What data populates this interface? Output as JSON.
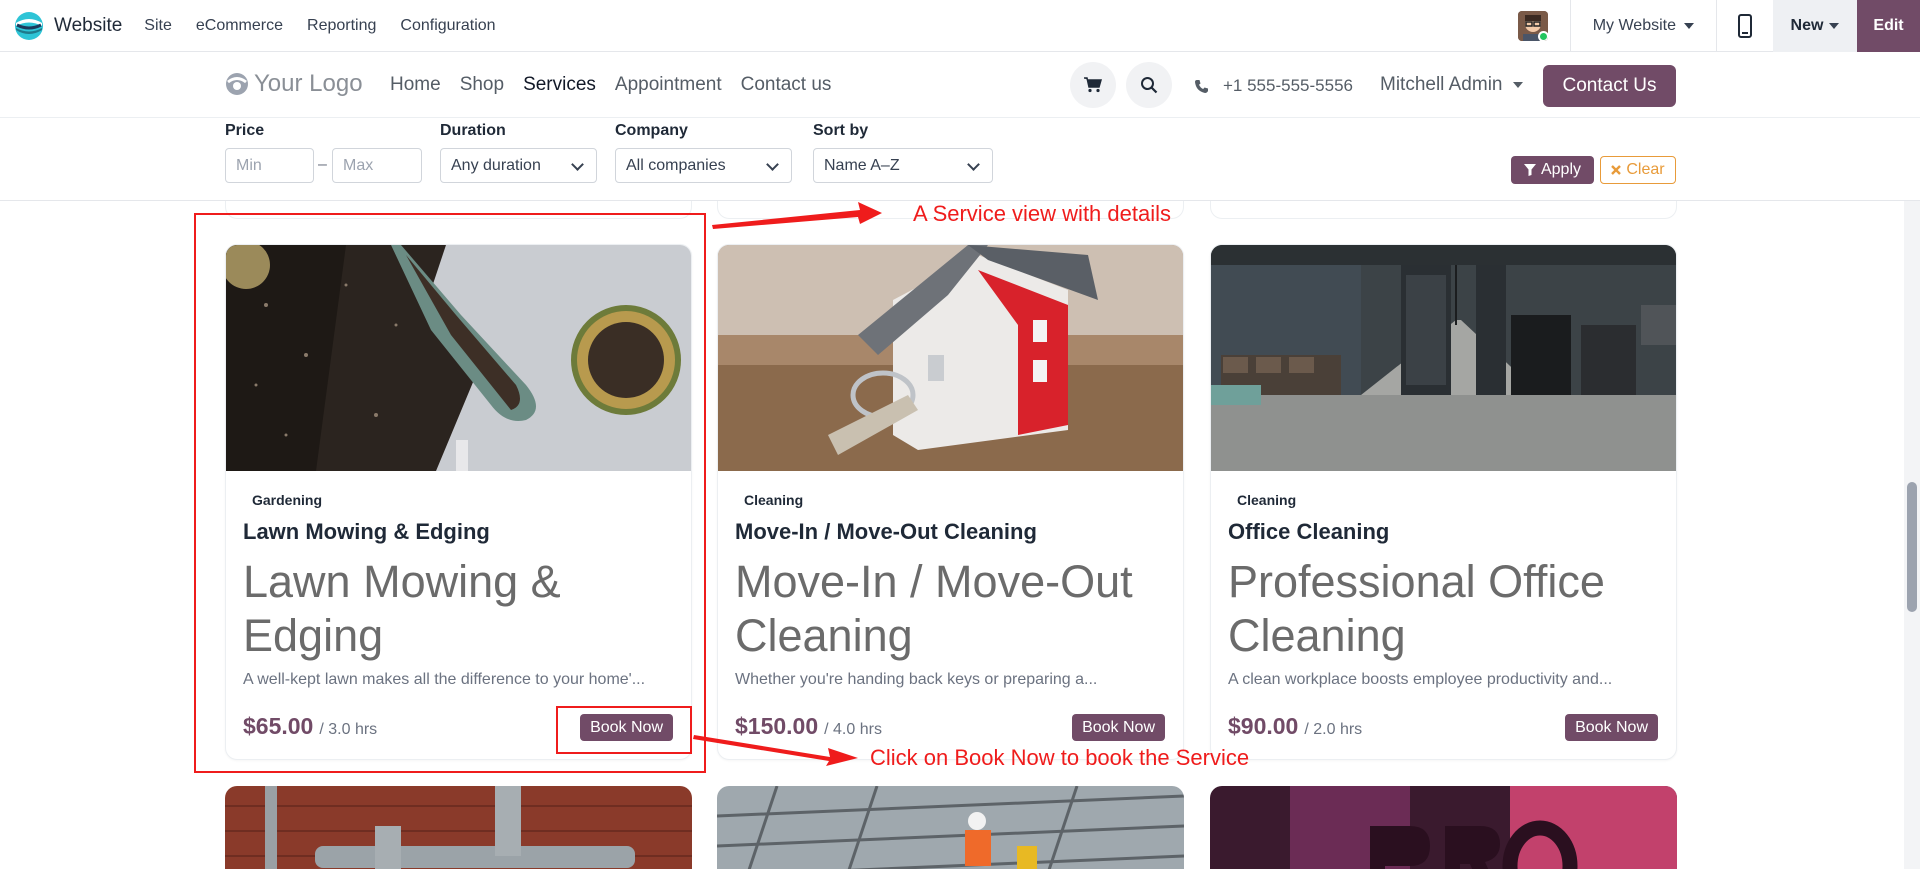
{
  "admin_bar": {
    "brand": "Website",
    "menu": [
      "Site",
      "eCommerce",
      "Reporting",
      "Configuration"
    ],
    "my_website": "My Website",
    "new_label": "New",
    "edit_label": "Edit"
  },
  "site_header": {
    "logo_text": "Your Logo",
    "nav": [
      "Home",
      "Shop",
      "Services",
      "Appointment",
      "Contact us"
    ],
    "active_nav": "Services",
    "phone": "+1 555-555-5556",
    "user": "Mitchell Admin",
    "contact_button": "Contact Us"
  },
  "filters": {
    "price_label": "Price",
    "min_placeholder": "Min",
    "max_placeholder": "Max",
    "duration_label": "Duration",
    "duration_value": "Any duration",
    "company_label": "Company",
    "company_value": "All companies",
    "sort_label": "Sort by",
    "sort_value": "Name A–Z",
    "apply_label": "Apply",
    "clear_label": "Clear"
  },
  "cards": [
    {
      "tag": "Gardening",
      "name": "Lawn Mowing & Edging",
      "big_title": "Lawn Mowing & Edging",
      "description": "A well-kept lawn makes all the difference to your home'...",
      "price": "$65.00",
      "duration": "/ 3.0 hrs",
      "book_label": "Book Now"
    },
    {
      "tag": "Cleaning",
      "name": "Move-In / Move-Out Cleaning",
      "big_title": "Move-In / Move-Out Cleaning",
      "description": "Whether you're handing back keys or preparing a...",
      "price": "$150.00",
      "duration": "/ 4.0 hrs",
      "book_label": "Book Now"
    },
    {
      "tag": "Cleaning",
      "name": "Office Cleaning",
      "big_title": "Professional Office Cleaning",
      "description": "A clean workplace boosts employee productivity and...",
      "price": "$90.00",
      "duration": "/ 2.0 hrs",
      "book_label": "Book Now"
    }
  ],
  "annotations": {
    "service_view": "A Service view with details",
    "book_now": "Click on Book Now to book the Service",
    "color": "#ef1c1c"
  },
  "colors": {
    "brand": "#714b67",
    "clear_accent": "#e89b3a"
  }
}
